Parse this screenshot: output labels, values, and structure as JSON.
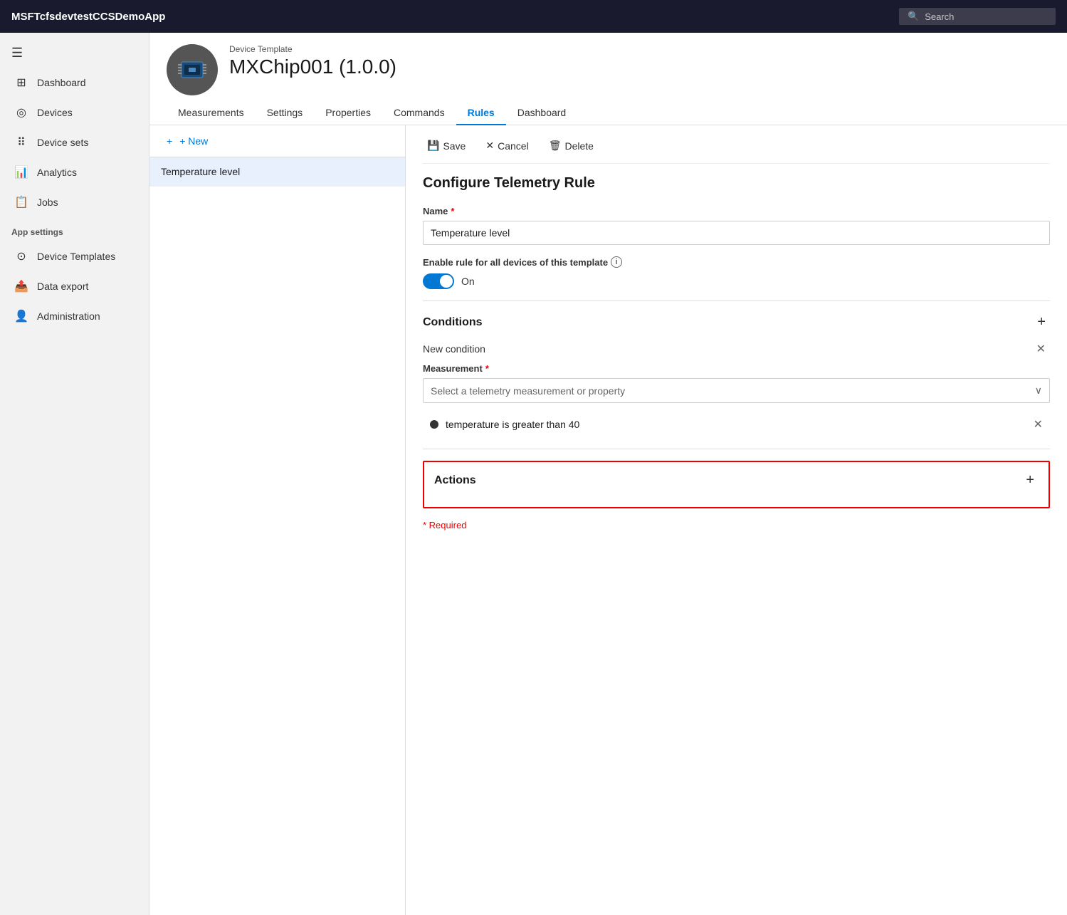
{
  "topbar": {
    "title": "MSFTcfsdevtestCCSDemoApp",
    "search_placeholder": "Search"
  },
  "sidebar": {
    "hamburger": "☰",
    "nav_items": [
      {
        "id": "dashboard",
        "label": "Dashboard",
        "icon": "⊞"
      },
      {
        "id": "devices",
        "label": "Devices",
        "icon": "◎"
      },
      {
        "id": "device-sets",
        "label": "Device sets",
        "icon": "⠿"
      },
      {
        "id": "analytics",
        "label": "Analytics",
        "icon": "📊"
      },
      {
        "id": "jobs",
        "label": "Jobs",
        "icon": "📋"
      }
    ],
    "app_settings_label": "App settings",
    "app_settings_items": [
      {
        "id": "device-templates",
        "label": "Device Templates",
        "icon": "⊙"
      },
      {
        "id": "data-export",
        "label": "Data export",
        "icon": "📤"
      },
      {
        "id": "administration",
        "label": "Administration",
        "icon": "👤"
      }
    ]
  },
  "device_header": {
    "template_label": "Device Template",
    "device_name": "MXChip001  (1.0.0)",
    "tabs": [
      {
        "id": "measurements",
        "label": "Measurements"
      },
      {
        "id": "settings",
        "label": "Settings"
      },
      {
        "id": "properties",
        "label": "Properties"
      },
      {
        "id": "commands",
        "label": "Commands"
      },
      {
        "id": "rules",
        "label": "Rules",
        "active": true
      },
      {
        "id": "dashboard",
        "label": "Dashboard"
      }
    ]
  },
  "left_panel": {
    "new_button": "+ New",
    "rules": [
      {
        "name": "Temperature level"
      }
    ]
  },
  "right_panel": {
    "toolbar": {
      "save": "Save",
      "cancel": "Cancel",
      "delete": "Delete"
    },
    "form_title": "Configure Telemetry Rule",
    "name_label": "Name",
    "name_value": "Temperature level",
    "enable_label": "Enable rule for all devices of this template",
    "toggle_on_label": "On",
    "conditions_label": "Conditions",
    "new_condition_label": "New condition",
    "measurement_label": "Measurement",
    "measurement_placeholder": "Select a telemetry measurement or property",
    "condition_text": "temperature is greater than 40",
    "actions_label": "Actions",
    "required_note": "* Required"
  }
}
